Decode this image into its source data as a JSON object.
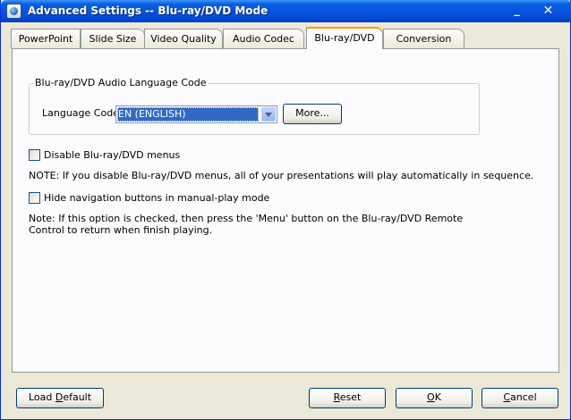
{
  "window": {
    "title": "Advanced Settings -- Blu-ray/DVD Mode",
    "minimize_glyph": "_",
    "close_glyph": "✕"
  },
  "tabs": [
    {
      "label": "PowerPoint",
      "active": false
    },
    {
      "label": "Slide Size",
      "active": false
    },
    {
      "label": "Video Quality",
      "active": false
    },
    {
      "label": "Audio Codec",
      "active": false
    },
    {
      "label": "Blu-ray/DVD",
      "active": true
    },
    {
      "label": "Conversion",
      "active": false
    }
  ],
  "audio_group": {
    "legend": "Blu-ray/DVD Audio Language Code",
    "language_label": "Language Code:",
    "language_value": "EN (ENGLISH)",
    "more_button": "More..."
  },
  "options": {
    "disable_menus_label": "Disable Blu-ray/DVD menus",
    "disable_menus_checked": false,
    "disable_menus_note": "NOTE: If you disable Blu-ray/DVD menus, all of your presentations will play automatically in sequence.",
    "hide_nav_label": "Hide navigation buttons in manual-play mode",
    "hide_nav_checked": false,
    "hide_nav_note": "Note: If this option is checked, then press the 'Menu' button on the Blu-ray/DVD Remote Control to return when finish playing."
  },
  "footer": {
    "load_default_prefix": "Load ",
    "load_default_ul": "D",
    "load_default_suffix": "efault",
    "reset_ul": "R",
    "reset_suffix": "eset",
    "ok_ul": "O",
    "ok_suffix": "K",
    "cancel_ul": "C",
    "cancel_suffix": "ancel"
  },
  "colors": {
    "titlebar": "#0553e2",
    "dialog_bg": "#ece9d8",
    "selection": "#316ac5",
    "active_tab_accent": "#ff9900"
  }
}
